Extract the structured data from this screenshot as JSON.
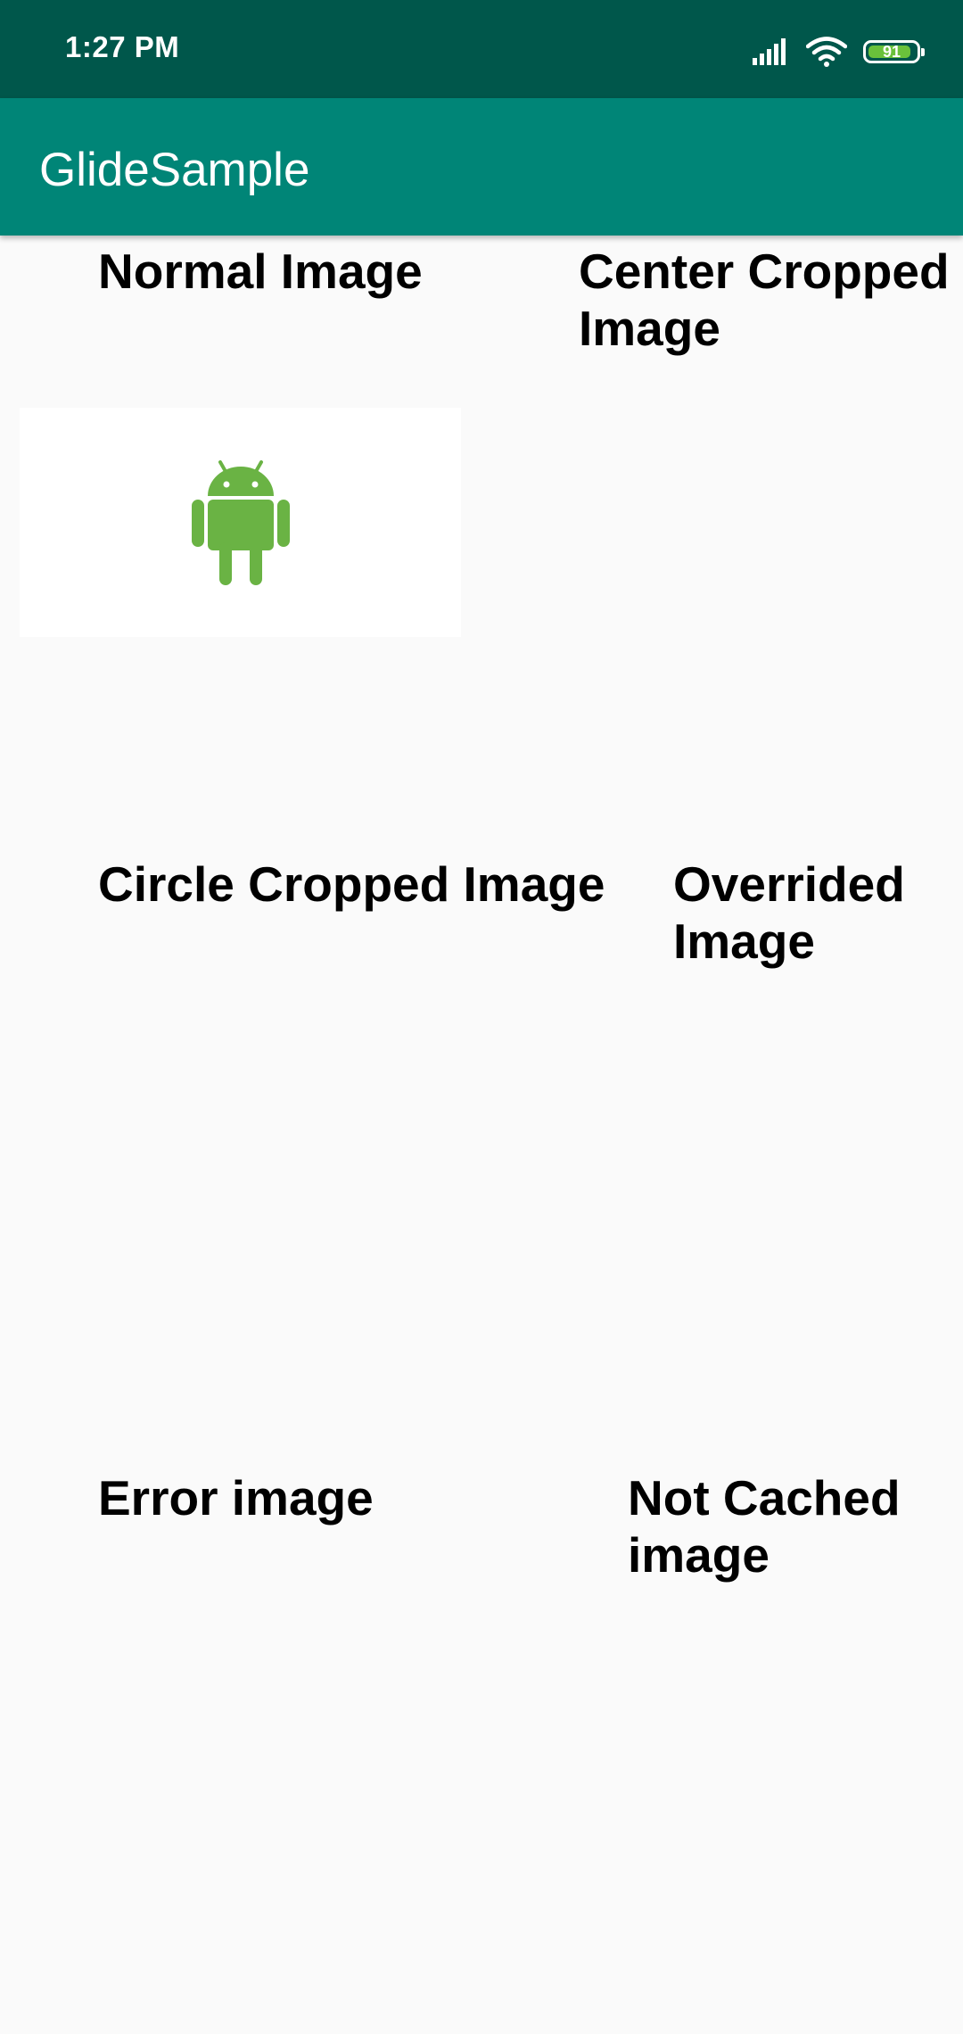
{
  "status_bar": {
    "time": "1:27 PM",
    "battery_level": "91",
    "battery_fraction": 0.91,
    "icons": [
      "signal-icon",
      "wifi-icon",
      "battery-icon"
    ]
  },
  "app_bar": {
    "title": "GlideSample"
  },
  "sections": {
    "normal_image": "Normal Image",
    "center_cropped_image": "Center Cropped Image",
    "circle_cropped_image": "Circle Cropped Image",
    "overrided_image": "Overrided Image",
    "error_image": "Error image",
    "not_cached_image": "Not Cached image"
  },
  "colors": {
    "status_bar": "#00574b",
    "app_bar": "#008577",
    "background": "#fafafa",
    "android_green": "#6ab344",
    "battery_fill": "#6ac13b"
  }
}
